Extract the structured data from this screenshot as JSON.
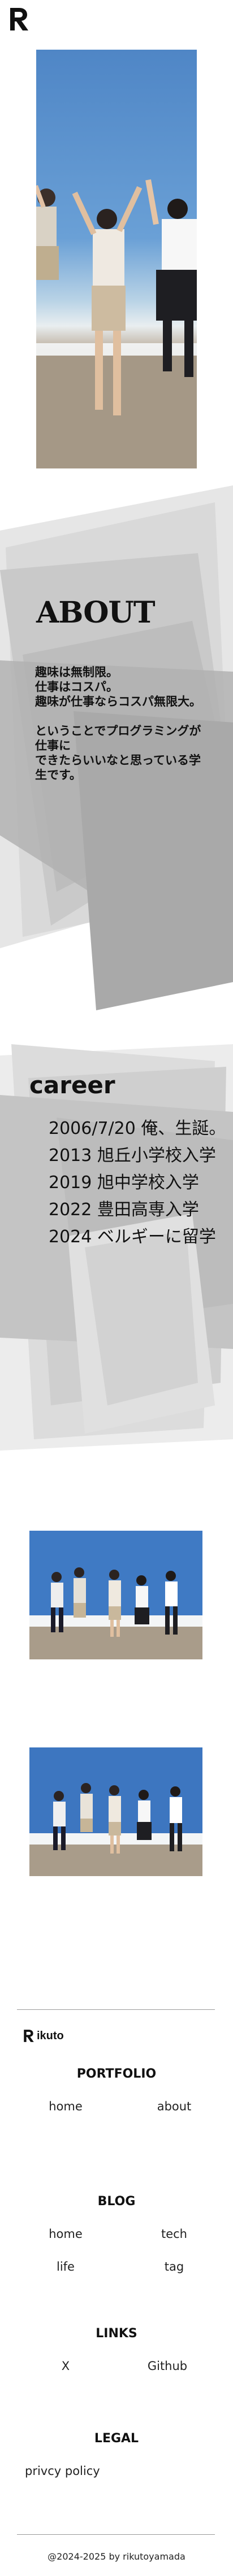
{
  "header": {
    "logo_letter": "R"
  },
  "about": {
    "title": "ABOUT",
    "text": "趣味は無制限。\n仕事はコスパ。\n趣味が仕事ならコスパ無限大。\n\nということでプログラミングが仕事に\nできたらいいなと思っている学生です。"
  },
  "career": {
    "title": "career",
    "items": [
      "2006/7/20 俺、生誕。",
      "2013 旭丘小学校入学",
      "2019 旭中学校入学",
      "2022 豊田高専入学",
      "2024 ベルギーに留学"
    ]
  },
  "footer": {
    "brand": "ikuto",
    "sections": {
      "portfolio": {
        "title": "PORTFOLIO",
        "links": [
          "home",
          "about"
        ]
      },
      "blog": {
        "title": "BLOG",
        "links": [
          "home",
          "tech",
          "life",
          "tag"
        ]
      },
      "links": {
        "title": "LINKS",
        "links": [
          "X",
          "Github"
        ]
      },
      "legal": {
        "title": "LEGAL",
        "links": [
          "privcy policy"
        ]
      }
    },
    "copyright": "@2024-2025 by rikutoyamada"
  },
  "colors": {
    "gray_dark": "#a9a9a9",
    "gray_mid": "#c8c8c8",
    "gray_light": "#e4e4e4",
    "sky": "#5b8fcb"
  }
}
